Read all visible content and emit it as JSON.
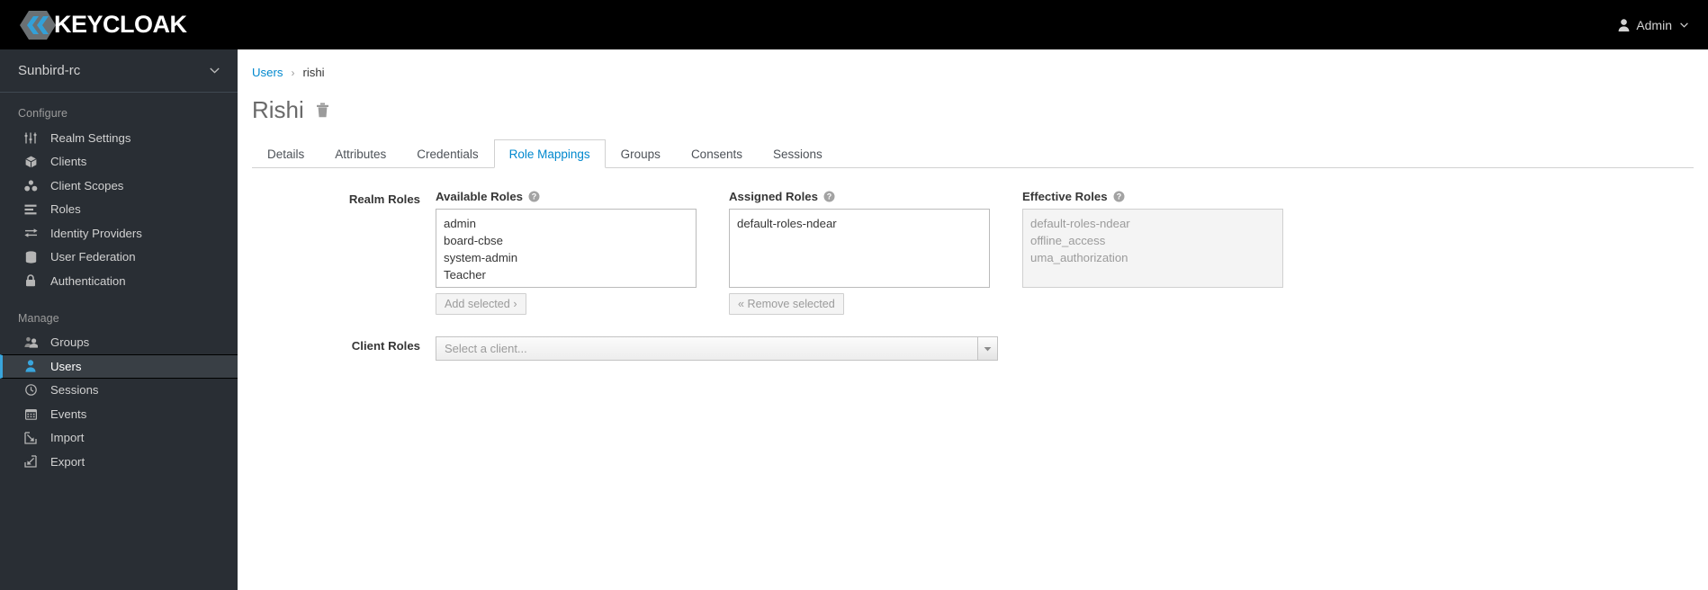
{
  "topbar": {
    "logo_text": "KEYCLOAK",
    "logo_icon": "keycloak-logo-icon",
    "admin_label": "Admin",
    "admin_icon": "user-icon",
    "admin_caret_icon": "chevron-down-icon"
  },
  "sidebar": {
    "realm": {
      "name": "Sunbird-rc",
      "caret_icon": "chevron-down-icon"
    },
    "sections": [
      {
        "title": "Configure",
        "items": [
          {
            "label": "Realm Settings",
            "icon": "sliders-icon",
            "active": false
          },
          {
            "label": "Clients",
            "icon": "cube-icon",
            "active": false
          },
          {
            "label": "Client Scopes",
            "icon": "cubes-icon",
            "active": false
          },
          {
            "label": "Roles",
            "icon": "list-icon",
            "active": false
          },
          {
            "label": "Identity Providers",
            "icon": "exchange-icon",
            "active": false
          },
          {
            "label": "User Federation",
            "icon": "database-icon",
            "active": false
          },
          {
            "label": "Authentication",
            "icon": "lock-icon",
            "active": false
          }
        ]
      },
      {
        "title": "Manage",
        "items": [
          {
            "label": "Groups",
            "icon": "users-icon",
            "active": false
          },
          {
            "label": "Users",
            "icon": "user-icon",
            "active": true
          },
          {
            "label": "Sessions",
            "icon": "clock-icon",
            "active": false
          },
          {
            "label": "Events",
            "icon": "calendar-icon",
            "active": false
          },
          {
            "label": "Import",
            "icon": "import-arrow-icon",
            "active": false
          },
          {
            "label": "Export",
            "icon": "export-arrow-icon",
            "active": false
          }
        ]
      }
    ]
  },
  "main": {
    "breadcrumb": {
      "root": "Users",
      "separator": "›",
      "current": "rishi"
    },
    "page_title": "Rishi",
    "delete_icon": "trash-icon",
    "tabs": [
      {
        "label": "Details",
        "active": false
      },
      {
        "label": "Attributes",
        "active": false
      },
      {
        "label": "Credentials",
        "active": false
      },
      {
        "label": "Role Mappings",
        "active": true
      },
      {
        "label": "Groups",
        "active": false
      },
      {
        "label": "Consents",
        "active": false
      },
      {
        "label": "Sessions",
        "active": false
      }
    ],
    "realm_roles": {
      "label": "Realm Roles",
      "available": {
        "title": "Available Roles",
        "help_icon": "help-circle-icon",
        "options": [
          "admin",
          "board-cbse",
          "system-admin",
          "Teacher"
        ],
        "button": "Add selected ›"
      },
      "assigned": {
        "title": "Assigned Roles",
        "help_icon": "help-circle-icon",
        "options": [
          "default-roles-ndear"
        ],
        "button": "« Remove selected"
      },
      "effective": {
        "title": "Effective Roles",
        "help_icon": "help-circle-icon",
        "options": [
          "default-roles-ndear",
          "offline_access",
          "uma_authorization"
        ]
      }
    },
    "client_roles": {
      "label": "Client Roles",
      "placeholder": "Select a client...",
      "caret_icon": "caret-down-icon"
    }
  },
  "colors": {
    "topbar_bg": "#000000",
    "sidebar_bg": "#292e34",
    "active_accent": "#39a5dc",
    "link_blue": "#0088ce",
    "logo_blue": "#33a0d8"
  }
}
